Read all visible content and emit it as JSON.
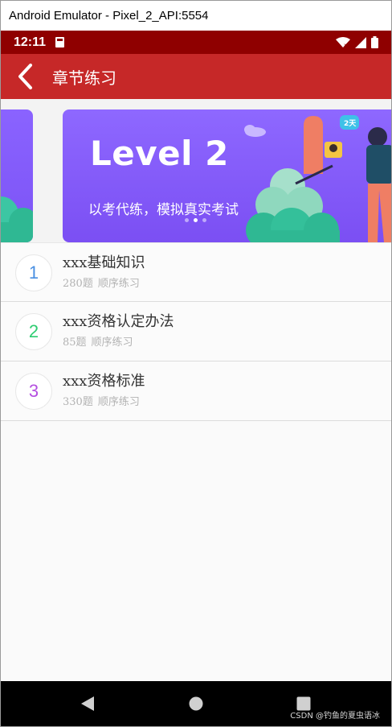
{
  "window": {
    "title": "Android Emulator - Pixel_2_API:5554"
  },
  "status_bar": {
    "time": "12:11",
    "icons": [
      "sd-card-icon",
      "wifi-icon",
      "signal-icon",
      "battery-icon"
    ]
  },
  "app_bar": {
    "title": "章节练习",
    "back_icon": "back-arrow-icon"
  },
  "banner": {
    "heading": "Level 2",
    "subtitle": "以考代练，模拟真实考试",
    "badge": "2天",
    "page_count": 3,
    "active_page": 2
  },
  "chapters": [
    {
      "number": "1",
      "name": "xxx基础知识",
      "count": "280题",
      "mode": "顺序练习",
      "color": "#4a90e2"
    },
    {
      "number": "2",
      "name": "xxx资格认定办法",
      "count": "85题",
      "mode": "顺序练习",
      "color": "#2ecc71"
    },
    {
      "number": "3",
      "name": "xxx资格标准",
      "count": "330题",
      "mode": "顺序练习",
      "color": "#b44fe0"
    }
  ],
  "nav_bar": {
    "buttons": [
      "back-triangle-icon",
      "home-circle-icon",
      "recents-square-icon"
    ]
  },
  "watermark": "CSDN @钓鱼的夏虫语冰",
  "colors": {
    "status_bar": "#8f0000",
    "app_bar": "#c62828",
    "banner": "#8e68ff"
  }
}
